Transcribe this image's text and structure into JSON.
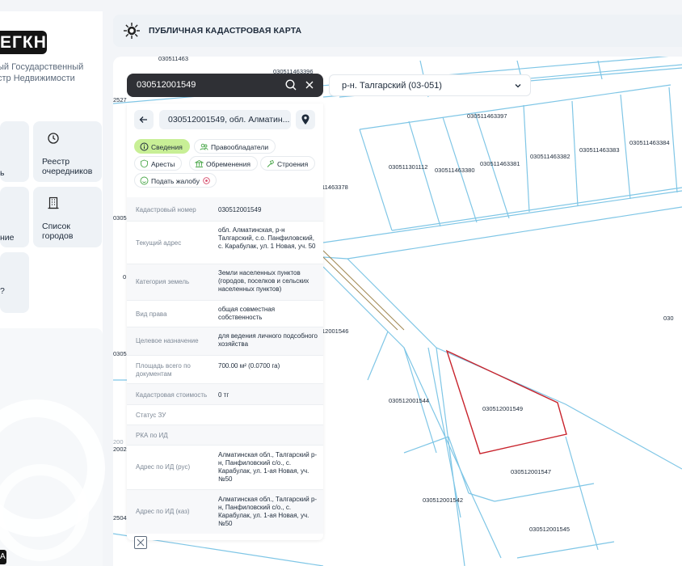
{
  "brand": {
    "badge": "ЕГКН",
    "subtitle": "ый Государственный\nстр Недвижимости"
  },
  "nav": [
    {
      "label": "ь",
      "icon": "document-icon"
    },
    {
      "label": "Реестр очередников",
      "icon": "clock-icon"
    },
    {
      "label": "ние",
      "icon": "grid-icon"
    },
    {
      "label": "Список городов",
      "icon": "building-icon"
    },
    {
      "label": "?",
      "icon": "question-icon"
    }
  ],
  "bottom_chip": "A",
  "header": {
    "title": "ПУБЛИЧНАЯ КАДАСТРОВАЯ КАРТА"
  },
  "search": {
    "value": "030512001549"
  },
  "district": {
    "value": "р-н. Талгарский (03-051)"
  },
  "panel": {
    "title": "030512001549, обл. Алматин...",
    "chips": [
      {
        "label": "Сведения",
        "active": true,
        "icon": "info-icon"
      },
      {
        "label": "Правообладатели",
        "active": false,
        "icon": "people-icon"
      },
      {
        "label": "Аресты",
        "active": false,
        "icon": "shield-icon"
      },
      {
        "label": "Обременения",
        "active": false,
        "icon": "bank-icon"
      },
      {
        "label": "Строения",
        "active": false,
        "icon": "hammer-icon"
      },
      {
        "label": "Подать жалобу",
        "active": false,
        "icon": "smile-icon"
      }
    ],
    "rows": [
      {
        "key": "Кадастровый номер",
        "value": "030512001549"
      },
      {
        "key": "Текущий адрес",
        "value": "обл. Алматинская, р-н Талгарский, с.о. Панфиловский, с. Карабулак, ул. 1 Новая, уч. 50"
      },
      {
        "key": "Категория земель",
        "value": "Земли населенных пунктов (городов, поселков и сельских населенных пунктов)"
      },
      {
        "key": "Вид права",
        "value": "общая совместная собственность"
      },
      {
        "key": "Целевое назначение",
        "value": "для ведения личного подсобного хозяйства"
      },
      {
        "key": "Площадь всего по документам",
        "value": "700.00 м² (0.0700 га)"
      },
      {
        "key": "Кадастровая стоимость",
        "value": "0 тг"
      },
      {
        "key": "Статус ЗУ",
        "value": ""
      },
      {
        "key": "РКА по ИД",
        "value": ""
      },
      {
        "key": "Адрес по ИД (рус)",
        "value": "Алматинская обл., Талгарский р-н, Панфиловский с/о., с. Карабулак, ул. 1-ая Новая, уч. №50"
      },
      {
        "key": "Адрес по ИД (каз)",
        "value": "Алматинская обл., Талгарский р-н, Панфиловский с/о., с. Карабулак, ул. 1-ая Новая, уч. №50"
      }
    ]
  },
  "map": {
    "selected_color": "#c8232c",
    "line_color": "#7fc6e6",
    "labels": [
      "030511463396",
      "030511463397",
      "030511301112",
      "030511463380",
      "030511463381",
      "030511463382",
      "030511463383",
      "030511463384",
      "11463378",
      "12001546",
      "030512001544",
      "030512001549",
      "030512001547",
      "030512001542",
      "030512001545",
      "2527",
      "0305",
      "030",
      "0305",
      "0",
      "20025",
      "2504",
      "030511463",
      "200"
    ]
  }
}
